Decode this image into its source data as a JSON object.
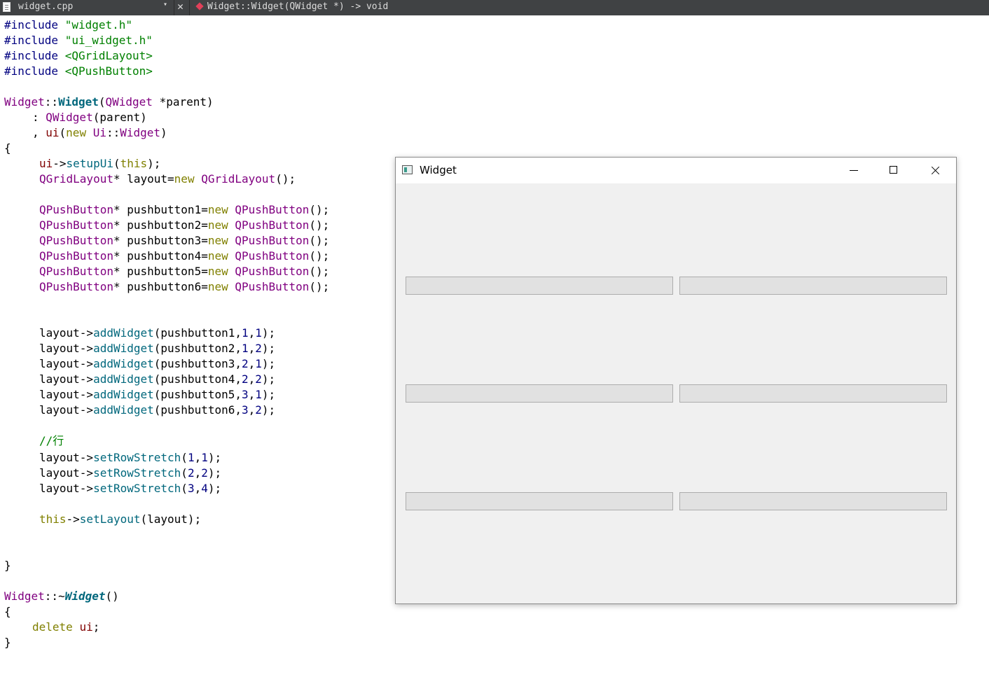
{
  "tab": {
    "file_name": "widget.cpp",
    "dropdown_icon": "▾",
    "close_icon": "✕",
    "symbol": "Widget::Widget(QWidget *) -> void"
  },
  "code": {
    "inc1_kw": "#include",
    "inc1_file": "\"widget.h\"",
    "inc2_kw": "#include",
    "inc2_file": "\"ui_widget.h\"",
    "inc3_kw": "#include",
    "inc3_file": "<QGridLayout>",
    "inc4_kw": "#include",
    "inc4_file": "<QPushButton>",
    "ctor_class": "Widget",
    "ctor_sep": "::",
    "ctor_name": "Widget",
    "ctor_open": "(",
    "ctor_ptype": "QWidget",
    "ctor_param": " *parent)",
    "init1_colon": ": ",
    "init1_base": "QWidget",
    "init1_rest": "(parent)",
    "init2_comma": ", ",
    "init2_ui": "ui",
    "init2_open": "(",
    "init2_new": "new",
    "init2_sp": " ",
    "init2_ns": "Ui",
    "init2_sep": "::",
    "init2_cls": "Widget",
    "init2_close": ")",
    "brace_open": "{",
    "setup_ui": "ui",
    "setup_arrow": "->",
    "setup_fn": "setupUi",
    "setup_open": "(",
    "setup_this": "this",
    "setup_close": ");",
    "grid_type": "QGridLayout",
    "grid_rest": "* layout=",
    "grid_new": "new",
    "grid_sp": " ",
    "grid_cls": "QGridLayout",
    "grid_end": "();",
    "buttons": [
      {
        "type": "QPushButton",
        "name": "* pushbutton1=",
        "new": "new",
        "cls": "QPushButton",
        "end": "();"
      },
      {
        "type": "QPushButton",
        "name": "* pushbutton2=",
        "new": "new",
        "cls": "QPushButton",
        "end": "();"
      },
      {
        "type": "QPushButton",
        "name": "* pushbutton3=",
        "new": "new",
        "cls": "QPushButton",
        "end": "();"
      },
      {
        "type": "QPushButton",
        "name": "* pushbutton4=",
        "new": "new",
        "cls": "QPushButton",
        "end": "();"
      },
      {
        "type": "QPushButton",
        "name": "* pushbutton5=",
        "new": "new",
        "cls": "QPushButton",
        "end": "();"
      },
      {
        "type": "QPushButton",
        "name": "* pushbutton6=",
        "new": "new",
        "cls": "QPushButton",
        "end": "();"
      }
    ],
    "adds": [
      {
        "obj": "layout->",
        "fn": "addWidget",
        "arg": "(pushbutton1,",
        "r": "1",
        "c1": ",",
        "c": "1",
        "end": ");"
      },
      {
        "obj": "layout->",
        "fn": "addWidget",
        "arg": "(pushbutton2,",
        "r": "1",
        "c1": ",",
        "c": "2",
        "end": ");"
      },
      {
        "obj": "layout->",
        "fn": "addWidget",
        "arg": "(pushbutton3,",
        "r": "2",
        "c1": ",",
        "c": "1",
        "end": ");"
      },
      {
        "obj": "layout->",
        "fn": "addWidget",
        "arg": "(pushbutton4,",
        "r": "2",
        "c1": ",",
        "c": "2",
        "end": ");"
      },
      {
        "obj": "layout->",
        "fn": "addWidget",
        "arg": "(pushbutton5,",
        "r": "3",
        "c1": ",",
        "c": "1",
        "end": ");"
      },
      {
        "obj": "layout->",
        "fn": "addWidget",
        "arg": "(pushbutton6,",
        "r": "3",
        "c1": ",",
        "c": "2",
        "end": ");"
      }
    ],
    "comment": "//行",
    "stretches": [
      {
        "obj": "layout->",
        "fn": "setRowStretch",
        "open": "(",
        "r": "1",
        "c1": ",",
        "v": "1",
        "end": ");"
      },
      {
        "obj": "layout->",
        "fn": "setRowStretch",
        "open": "(",
        "r": "2",
        "c1": ",",
        "v": "2",
        "end": ");"
      },
      {
        "obj": "layout->",
        "fn": "setRowStretch",
        "open": "(",
        "r": "3",
        "c1": ",",
        "v": "4",
        "end": ");"
      }
    ],
    "setlayout_this": "this",
    "setlayout_arrow": "->",
    "setlayout_fn": "setLayout",
    "setlayout_rest": "(layout);",
    "brace_close": "}",
    "dtor_class": "Widget",
    "dtor_sep": "::~",
    "dtor_name": "Widget",
    "dtor_rest": "()",
    "dtor_open": "{",
    "delete_kw": "delete",
    "delete_sp": " ",
    "delete_ui": "ui",
    "delete_end": ";",
    "dtor_close": "}"
  },
  "window": {
    "title": "Widget",
    "app_icon": "window-icon",
    "minimize_icon": "minimize-icon",
    "maximize_icon": "maximize-icon",
    "close_icon": "close-icon"
  }
}
